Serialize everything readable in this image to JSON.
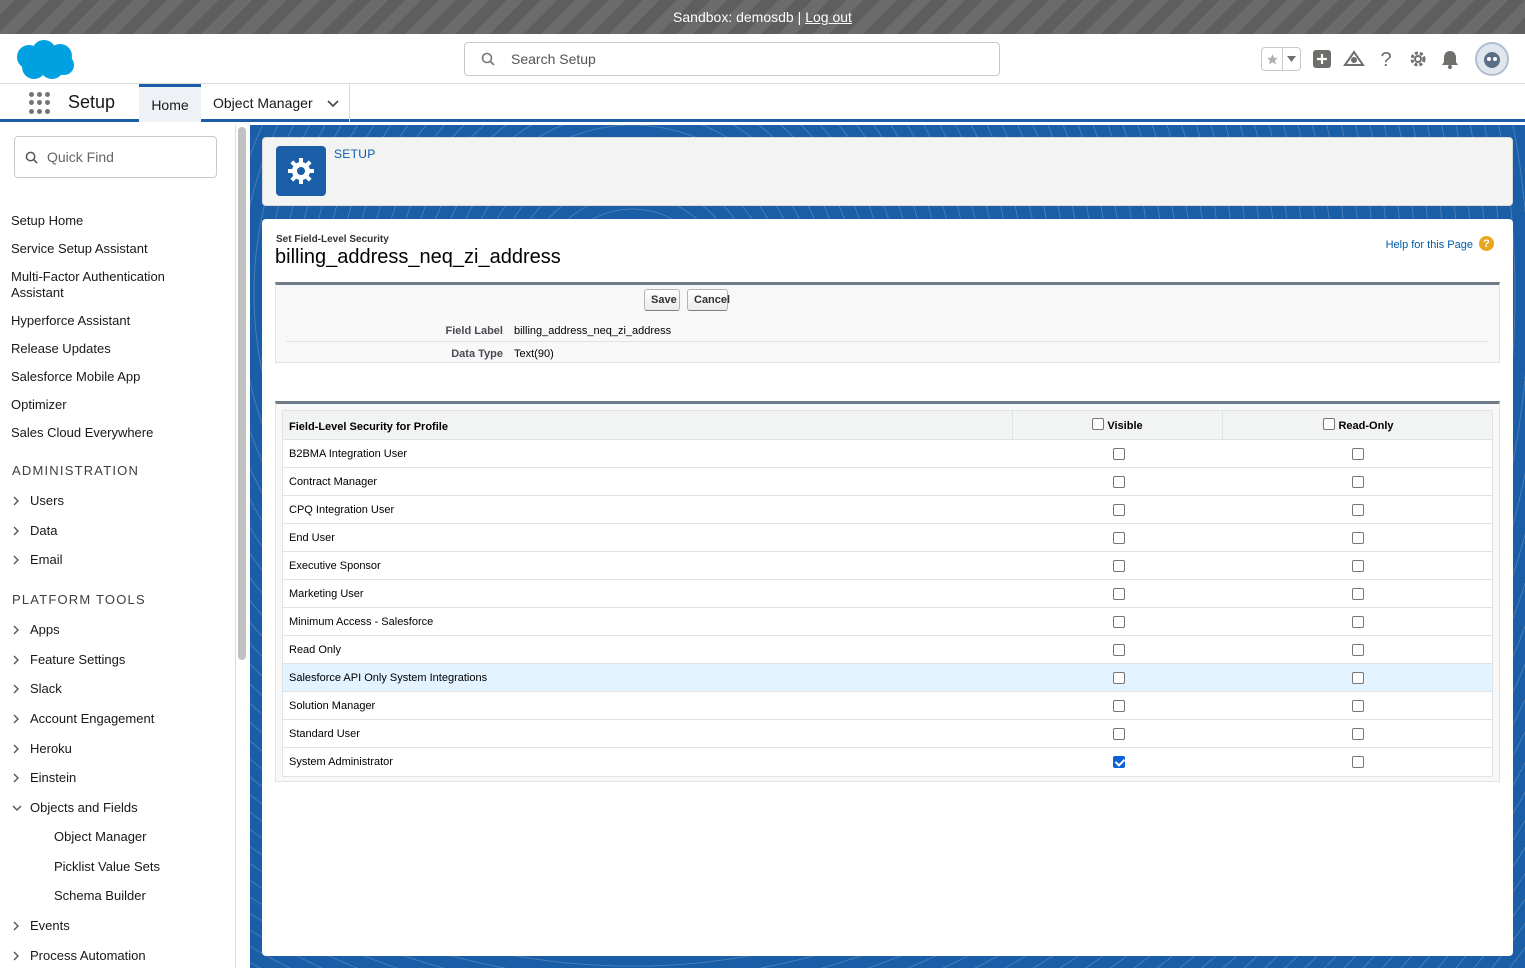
{
  "sandbox_bar": {
    "text": "Sandbox: demosdb |",
    "logout": "Log out"
  },
  "header": {
    "search_placeholder": "Search Setup",
    "icons": [
      "star-icon",
      "chevron-down-icon",
      "add-icon",
      "trailhead-icon",
      "help-icon",
      "gear-icon",
      "bell-icon",
      "avatar"
    ]
  },
  "nav": {
    "app_name": "Setup",
    "tabs": [
      {
        "label": "Home"
      },
      {
        "label": "Object Manager"
      }
    ]
  },
  "sidebar": {
    "quick_find_placeholder": "Quick Find",
    "links": [
      "Setup Home",
      "Service Setup Assistant",
      "Multi-Factor Authentication Assistant",
      "Hyperforce Assistant",
      "Release Updates",
      "Salesforce Mobile App",
      "Optimizer",
      "Sales Cloud Everywhere"
    ],
    "sections": [
      "ADMINISTRATION",
      "PLATFORM TOOLS"
    ],
    "admin_items": [
      "Users",
      "Data",
      "Email"
    ],
    "platform_items": [
      "Apps",
      "Feature Settings",
      "Slack",
      "Account Engagement",
      "Heroku",
      "Einstein",
      "Objects and Fields"
    ],
    "objects_children": [
      "Object Manager",
      "Picklist Value Sets",
      "Schema Builder"
    ],
    "after_items": [
      "Events",
      "Process Automation"
    ]
  },
  "setup_header": {
    "label": "SETUP"
  },
  "page": {
    "type": "Set Field-Level Security",
    "title": "billing_address_neq_zi_address",
    "help_link": "Help for this Page",
    "help_icon_glyph": "?",
    "buttons": {
      "save": "Save",
      "cancel": "Cancel"
    },
    "details": [
      {
        "label": "Field Label",
        "value": "billing_address_neq_zi_address"
      },
      {
        "label": "Data Type",
        "value": "Text(90)"
      }
    ]
  },
  "fls": {
    "col_profile": "Field-Level Security for Profile",
    "col_visible": "Visible",
    "col_readonly": "Read-Only",
    "rows": [
      {
        "profile": "B2BMA Integration User",
        "visible": false,
        "readonly": false
      },
      {
        "profile": "Contract Manager",
        "visible": false,
        "readonly": false
      },
      {
        "profile": "CPQ Integration User",
        "visible": false,
        "readonly": false
      },
      {
        "profile": "End User",
        "visible": false,
        "readonly": false
      },
      {
        "profile": "Executive Sponsor",
        "visible": false,
        "readonly": false
      },
      {
        "profile": "Marketing User",
        "visible": false,
        "readonly": false
      },
      {
        "profile": "Minimum Access - Salesforce",
        "visible": false,
        "readonly": false
      },
      {
        "profile": "Read Only",
        "visible": false,
        "readonly": false
      },
      {
        "profile": "Salesforce API Only System Integrations",
        "visible": false,
        "readonly": false
      },
      {
        "profile": "Solution Manager",
        "visible": false,
        "readonly": false
      },
      {
        "profile": "Standard User",
        "visible": false,
        "readonly": false
      },
      {
        "profile": "System Administrator",
        "visible": true,
        "readonly": false
      }
    ]
  },
  "colors": {
    "brand": "#1b5ea8",
    "link": "#0b5cab",
    "checkbox_checked": "#0b62d6",
    "row_highlight": "#e3f3ff"
  }
}
